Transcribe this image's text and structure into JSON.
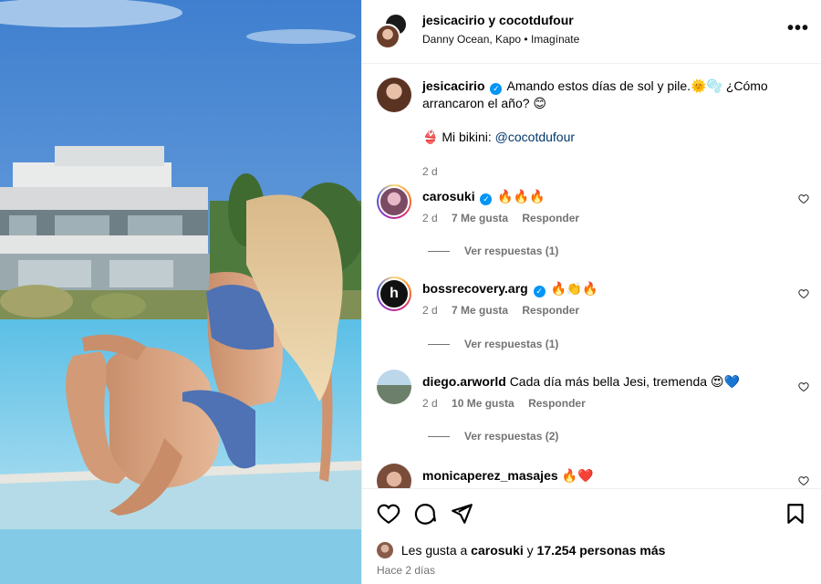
{
  "post": {
    "header": {
      "accounts": "jesicacirio y cocotdufour",
      "music": "Danny Ocean, Kapo • Imagínate",
      "more_label": "•••"
    },
    "caption": {
      "username": "jesicacirio",
      "text": "Amando estos días de sol y pile.🌞🫧 ¿Cómo arrancaron el año? 😊",
      "line2_prefix": "👙 Mi bikini: ",
      "line2_mention": "@cocotdufour",
      "time": "2 d"
    },
    "comments": [
      {
        "username": "carosuki",
        "verified": true,
        "text": "🔥🔥🔥",
        "time": "2 d",
        "likes": "7 Me gusta",
        "reply": "Responder",
        "view_replies": "Ver respuestas (1)"
      },
      {
        "username": "bossrecovery.arg",
        "verified": true,
        "text": "🔥👏🔥",
        "time": "2 d",
        "likes": "7 Me gusta",
        "reply": "Responder",
        "view_replies": "Ver respuestas (1)"
      },
      {
        "username": "diego.arworld",
        "verified": false,
        "text": "Cada día más bella Jesi, tremenda 😍💙",
        "time": "2 d",
        "likes": "10 Me gusta",
        "reply": "Responder",
        "view_replies": "Ver respuestas (2)"
      },
      {
        "username": "monicaperez_masajes",
        "verified": false,
        "text": "🔥❤️"
      }
    ],
    "footer": {
      "likes_prefix": "Les gusta a ",
      "likes_user": "carosuki",
      "likes_mid": " y ",
      "likes_count": "17.254 personas más",
      "date": "Hace 2 días"
    },
    "colors": {
      "verified": "#0095f6",
      "secondary_text": "#737373",
      "divider": "#efefef"
    }
  }
}
